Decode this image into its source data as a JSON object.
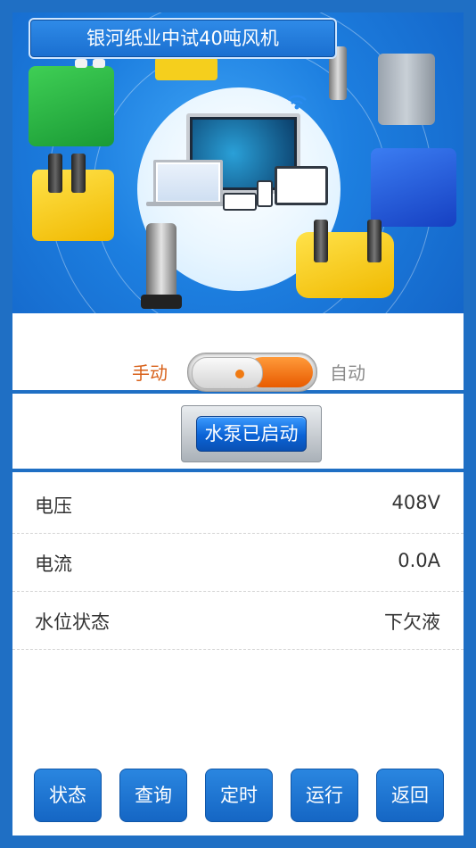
{
  "banner": {
    "title": "银河纸业中试40吨风机"
  },
  "mode": {
    "manual_label": "手动",
    "auto_label": "自动",
    "selected": "手动"
  },
  "pump": {
    "button_label": "水泵已启动"
  },
  "data_rows": [
    {
      "label": "电压",
      "value": "408V"
    },
    {
      "label": "电流",
      "value": "0.0A"
    },
    {
      "label": "水位状态",
      "value": "下欠液"
    }
  ],
  "nav": {
    "buttons": [
      "状态",
      "查询",
      "定时",
      "运行",
      "返回"
    ]
  },
  "colors": {
    "frame": "#1f6fc4",
    "accent_orange": "#e85b00",
    "button_blue": "#1566c4"
  }
}
